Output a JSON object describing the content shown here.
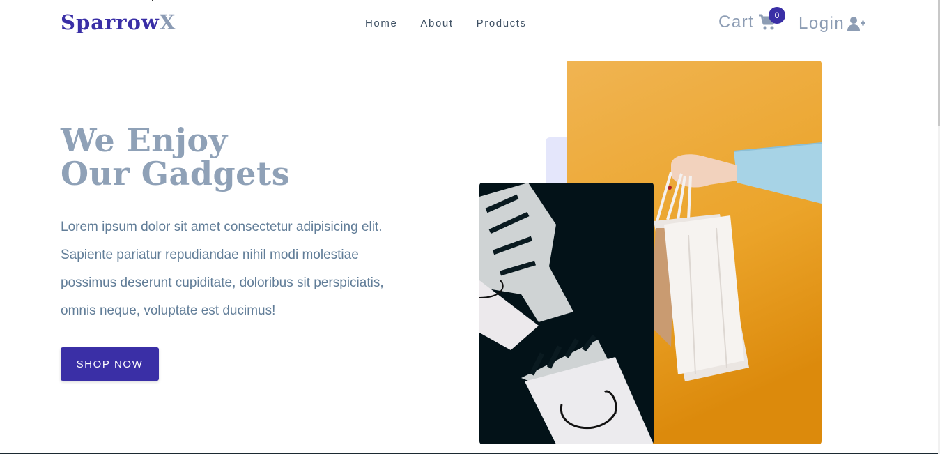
{
  "brand": {
    "name_primary": "Sparrow",
    "name_accent": "X"
  },
  "nav": {
    "links": [
      "Home",
      "About",
      "Products"
    ]
  },
  "cart": {
    "label": "Cart",
    "count": "0",
    "icon": "shopping-cart-icon"
  },
  "login": {
    "label": "Login",
    "icon": "user-plus-icon"
  },
  "hero": {
    "title_line1": "We Enjoy",
    "title_line2": "Our Gadgets",
    "text": "Lorem ipsum dolor sit amet consectetur adipisicing elit. Sapiente pariatur repudiandae nihil modi molestiae possimus deserunt cupiditate, doloribus sit perspiciatis, omnis neque, voluptate est ducimus!",
    "button": "SHOP NOW"
  },
  "colors": {
    "primary": "#3a2fa6",
    "heading": "#8fa1b7",
    "text": "#617d98",
    "accent_bg": "#e4e6fb",
    "hero_orange": "#eba42a"
  }
}
